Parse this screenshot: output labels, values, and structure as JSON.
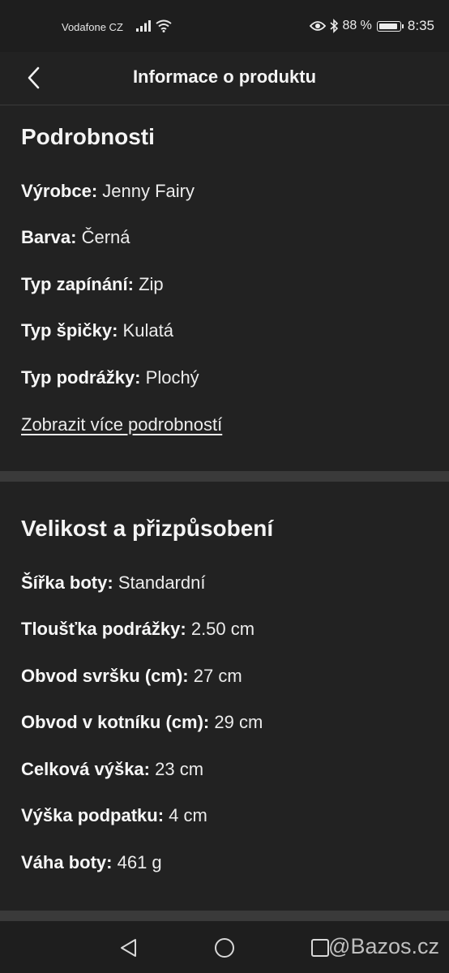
{
  "status_bar": {
    "carrier": "Vodafone CZ",
    "battery_percent": "88 %",
    "time": "8:35",
    "battery_level": 0.88
  },
  "header": {
    "title": "Informace o produktu",
    "back_icon": "chevron-left-icon"
  },
  "details": {
    "heading": "Podrobnosti",
    "items": [
      {
        "label": "Výrobce:",
        "value": "Jenny Fairy"
      },
      {
        "label": "Barva:",
        "value": "Černá"
      },
      {
        "label": "Typ zapínání:",
        "value": "Zip"
      },
      {
        "label": "Typ špičky:",
        "value": "Kulatá"
      },
      {
        "label": "Typ podrážky:",
        "value": "Plochý"
      }
    ],
    "more_link": "Zobrazit více podrobností"
  },
  "size": {
    "heading": "Velikost a přizpůsobení",
    "items": [
      {
        "label": "Šířka boty:",
        "value": "Standardní"
      },
      {
        "label": "Tloušťka podrážky:",
        "value": "2.50 cm"
      },
      {
        "label": "Obvod svršku (cm):",
        "value": "27 cm"
      },
      {
        "label": "Obvod v kotníku (cm):",
        "value": "29 cm"
      },
      {
        "label": "Celková výška:",
        "value": "23 cm"
      },
      {
        "label": "Výška podpatku:",
        "value": "4 cm"
      },
      {
        "label": "Váha boty:",
        "value": "461 g"
      }
    ]
  },
  "nav_bar": {
    "back_icon": "triangle-back-icon",
    "home_icon": "circle-home-icon",
    "recents_icon": "square-recents-icon"
  },
  "watermark": "@Bazos.cz"
}
